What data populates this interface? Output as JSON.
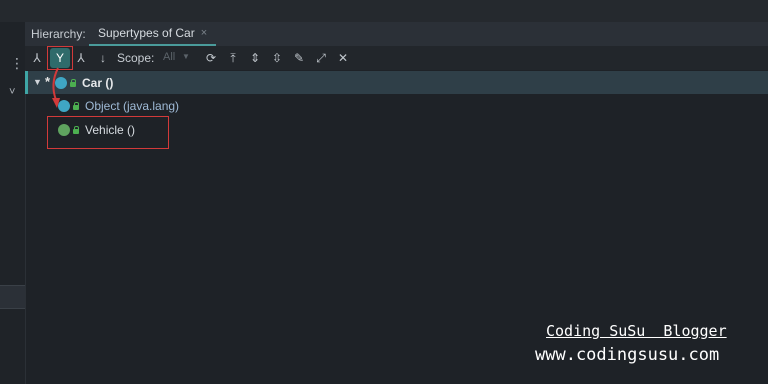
{
  "hierarchy_panel": {
    "prefix_label": "Hierarchy:",
    "active_tab": {
      "label": "Supertypes of Car",
      "close_glyph": "×"
    }
  },
  "toolbar": {
    "buttons": [
      {
        "name": "subtypes-hierarchy-icon",
        "glyph": "⅄"
      },
      {
        "name": "supertypes-hierarchy-icon",
        "glyph": "Y",
        "active": true
      },
      {
        "name": "class-hierarchy-icon",
        "glyph": "⅄"
      },
      {
        "name": "sort-alphabetically-icon",
        "glyph": "↓"
      }
    ],
    "scope_label": "Scope:",
    "scope_value": "All",
    "actions": [
      {
        "name": "refresh-icon",
        "glyph": "⟳"
      },
      {
        "name": "export-icon",
        "glyph": "⤒"
      },
      {
        "name": "expand-all-icon",
        "glyph": "⇕"
      },
      {
        "name": "collapse-all-icon",
        "glyph": "⇳"
      },
      {
        "name": "pin-icon",
        "glyph": "✎"
      },
      {
        "name": "open-in-window-icon",
        "glyph": "⤢"
      },
      {
        "name": "close-icon",
        "glyph": "✕"
      }
    ]
  },
  "tree": {
    "root": {
      "label": "Car ()",
      "marker": "*",
      "icon": "class-icon",
      "icon_color": "#3fa6c4"
    },
    "children": [
      {
        "label": "Object (java.lang)",
        "icon": "class-icon",
        "icon_color": "#3fa6c4"
      },
      {
        "label": "Vehicle ()",
        "icon": "interface-icon",
        "icon_color": "#5fa35f"
      }
    ]
  },
  "left_rail": {
    "menu_glyph": "⋮",
    "chevron_glyph": "˅"
  },
  "watermark": {
    "line1": "Coding SuSu  Blogger",
    "line2": "www.codingsusu.com"
  },
  "accent_colors": {
    "highlight_red": "#d23a3a",
    "selection": "#2f3f48",
    "teal": "#3fa6a6"
  }
}
